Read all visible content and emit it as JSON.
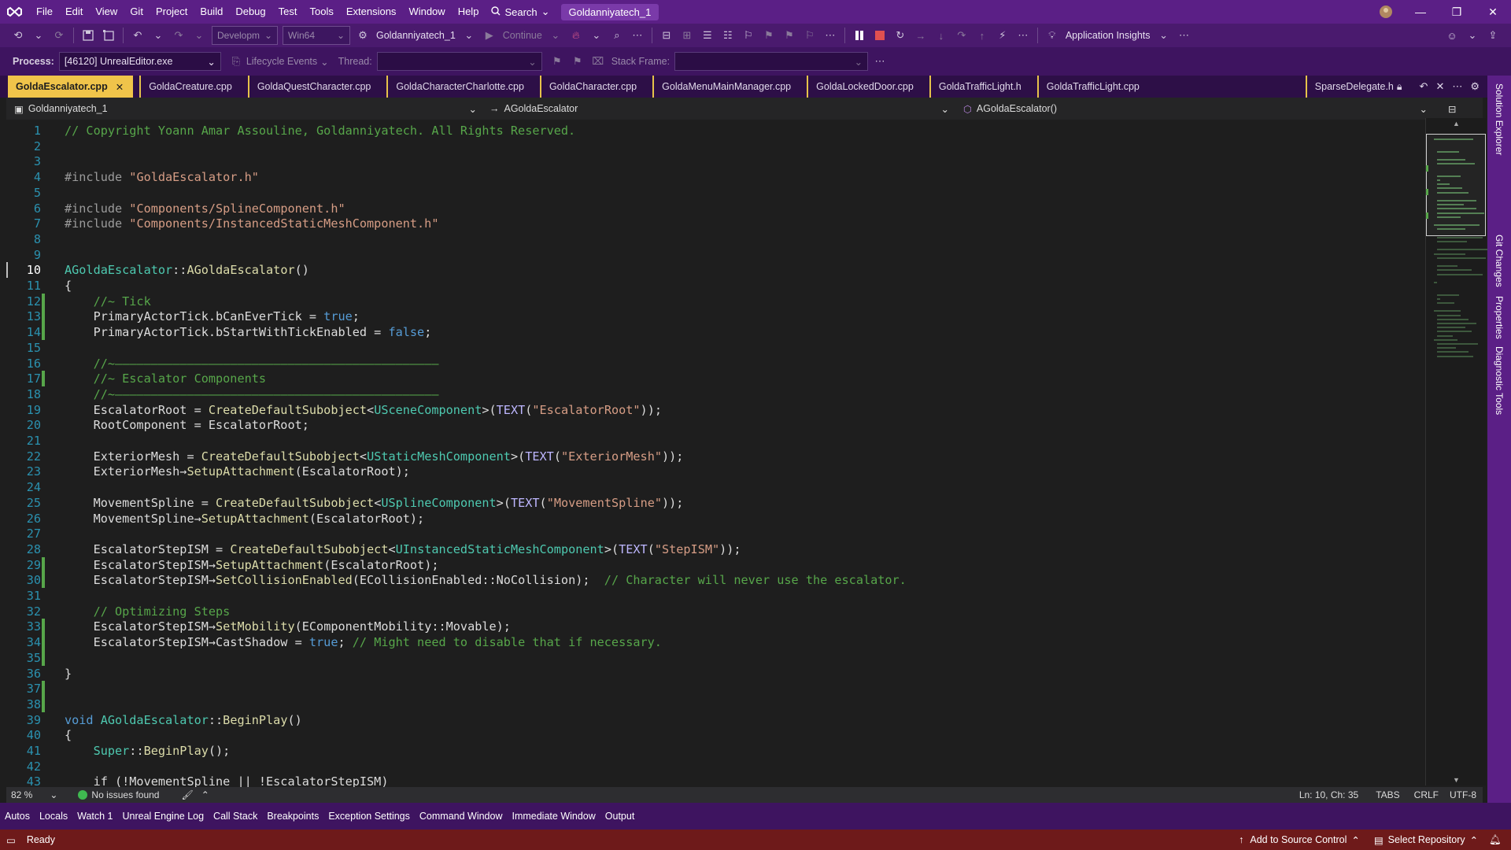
{
  "menubar": {
    "items": [
      "File",
      "Edit",
      "View",
      "Git",
      "Project",
      "Build",
      "Debug",
      "Test",
      "Tools",
      "Extensions",
      "Window",
      "Help"
    ],
    "search_label": "Search",
    "solution_name": "Goldanniyatech_1"
  },
  "toolbar": {
    "config": "Developm",
    "platform": "Win64",
    "startup_project": "Goldanniyatech_1",
    "continue_label": "Continue",
    "app_insights": "Application Insights"
  },
  "debugbar": {
    "process_label": "Process:",
    "process_value": "[46120] UnrealEditor.exe",
    "lifecycle_label": "Lifecycle Events",
    "thread_label": "Thread:",
    "stackframe_label": "Stack Frame:"
  },
  "tabs": {
    "items": [
      {
        "label": "GoldaEscalator.cpp",
        "active": true
      },
      {
        "label": "GoldaCreature.cpp"
      },
      {
        "label": "GoldaQuestCharacter.cpp"
      },
      {
        "label": "GoldaCharacterCharlotte.cpp"
      },
      {
        "label": "GoldaCharacter.cpp"
      },
      {
        "label": "GoldaMenuMainManager.cpp"
      },
      {
        "label": "GoldaLockedDoor.cpp"
      },
      {
        "label": "GoldaTrafficLight.h"
      },
      {
        "label": "GoldaTrafficLight.cpp"
      }
    ],
    "pinned": "SparseDelegate.h"
  },
  "navbar": {
    "project": "Goldanniyatech_1",
    "scope": "AGoldaEscalator",
    "member": "AGoldaEscalator()"
  },
  "rail": [
    "Solution Explorer",
    "Git Changes",
    "Properties",
    "Diagnostic Tools"
  ],
  "code": [
    {
      "n": "1",
      "parts": [
        [
          "cm",
          "// Copyright Yoann Amar Assouline, Goldanniyatech. All Rights Reserved."
        ]
      ]
    },
    {
      "n": "2",
      "parts": []
    },
    {
      "n": "3",
      "parts": []
    },
    {
      "n": "4",
      "parts": [
        [
          "pp",
          "#include "
        ],
        [
          "str",
          "\"GoldaEscalator.h\""
        ]
      ]
    },
    {
      "n": "5",
      "parts": []
    },
    {
      "n": "6",
      "parts": [
        [
          "pp",
          "#include "
        ],
        [
          "str",
          "\"Components/SplineComponent.h\""
        ]
      ]
    },
    {
      "n": "7",
      "parts": [
        [
          "pp",
          "#include "
        ],
        [
          "str",
          "\"Components/InstancedStaticMeshComponent.h\""
        ]
      ]
    },
    {
      "n": "8",
      "parts": []
    },
    {
      "n": "9",
      "parts": []
    },
    {
      "n": "10",
      "parts": [
        [
          "cls",
          "AGoldaEscalator"
        ],
        [
          "id",
          "::"
        ],
        [
          "fn",
          "AGoldaEscalator"
        ],
        [
          "id",
          "()"
        ]
      ]
    },
    {
      "n": "11",
      "parts": [
        [
          "id",
          "{"
        ]
      ]
    },
    {
      "n": "12",
      "parts": [
        [
          "cm",
          "    //~ Tick"
        ]
      ]
    },
    {
      "n": "13",
      "parts": [
        [
          "id",
          "    PrimaryActorTick.bCanEverTick = "
        ],
        [
          "kw",
          "true"
        ],
        [
          "id",
          ";"
        ]
      ]
    },
    {
      "n": "14",
      "parts": [
        [
          "id",
          "    PrimaryActorTick.bStartWithTickEnabled = "
        ],
        [
          "kw",
          "false"
        ],
        [
          "id",
          ";"
        ]
      ]
    },
    {
      "n": "15",
      "parts": []
    },
    {
      "n": "16",
      "parts": [
        [
          "cm",
          "    //~—————————————————————————————————————————————"
        ]
      ]
    },
    {
      "n": "17",
      "parts": [
        [
          "cm",
          "    //~ Escalator Components"
        ]
      ]
    },
    {
      "n": "18",
      "parts": [
        [
          "cm",
          "    //~—————————————————————————————————————————————"
        ]
      ]
    },
    {
      "n": "19",
      "parts": [
        [
          "id",
          "    EscalatorRoot = "
        ],
        [
          "fn",
          "CreateDefaultSubobject"
        ],
        [
          "id",
          "<"
        ],
        [
          "cls",
          "USceneComponent"
        ],
        [
          "id",
          ">("
        ],
        [
          "mac",
          "TEXT"
        ],
        [
          "id",
          "("
        ],
        [
          "str",
          "\"EscalatorRoot\""
        ],
        [
          "id",
          "));"
        ]
      ]
    },
    {
      "n": "20",
      "parts": [
        [
          "id",
          "    RootComponent = EscalatorRoot;"
        ]
      ]
    },
    {
      "n": "21",
      "parts": []
    },
    {
      "n": "22",
      "parts": [
        [
          "id",
          "    ExteriorMesh = "
        ],
        [
          "fn",
          "CreateDefaultSubobject"
        ],
        [
          "id",
          "<"
        ],
        [
          "cls",
          "UStaticMeshComponent"
        ],
        [
          "id",
          ">("
        ],
        [
          "mac",
          "TEXT"
        ],
        [
          "id",
          "("
        ],
        [
          "str",
          "\"ExteriorMesh\""
        ],
        [
          "id",
          "));"
        ]
      ]
    },
    {
      "n": "23",
      "parts": [
        [
          "id",
          "    ExteriorMesh→"
        ],
        [
          "fn",
          "SetupAttachment"
        ],
        [
          "id",
          "(EscalatorRoot);"
        ]
      ]
    },
    {
      "n": "24",
      "parts": []
    },
    {
      "n": "25",
      "parts": [
        [
          "id",
          "    MovementSpline = "
        ],
        [
          "fn",
          "CreateDefaultSubobject"
        ],
        [
          "id",
          "<"
        ],
        [
          "cls",
          "USplineComponent"
        ],
        [
          "id",
          ">("
        ],
        [
          "mac",
          "TEXT"
        ],
        [
          "id",
          "("
        ],
        [
          "str",
          "\"MovementSpline\""
        ],
        [
          "id",
          "));"
        ]
      ]
    },
    {
      "n": "26",
      "parts": [
        [
          "id",
          "    MovementSpline→"
        ],
        [
          "fn",
          "SetupAttachment"
        ],
        [
          "id",
          "(EscalatorRoot);"
        ]
      ]
    },
    {
      "n": "27",
      "parts": []
    },
    {
      "n": "28",
      "parts": [
        [
          "id",
          "    EscalatorStepISM = "
        ],
        [
          "fn",
          "CreateDefaultSubobject"
        ],
        [
          "id",
          "<"
        ],
        [
          "cls",
          "UInstancedStaticMeshComponent"
        ],
        [
          "id",
          ">("
        ],
        [
          "mac",
          "TEXT"
        ],
        [
          "id",
          "("
        ],
        [
          "str",
          "\"StepISM\""
        ],
        [
          "id",
          "));"
        ]
      ]
    },
    {
      "n": "29",
      "parts": [
        [
          "id",
          "    EscalatorStepISM→"
        ],
        [
          "fn",
          "SetupAttachment"
        ],
        [
          "id",
          "(EscalatorRoot);"
        ]
      ]
    },
    {
      "n": "30",
      "parts": [
        [
          "id",
          "    EscalatorStepISM→"
        ],
        [
          "fn",
          "SetCollisionEnabled"
        ],
        [
          "id",
          "(ECollisionEnabled::NoCollision);  "
        ],
        [
          "cm",
          "// Character will never use the escalator."
        ]
      ]
    },
    {
      "n": "31",
      "parts": []
    },
    {
      "n": "32",
      "parts": [
        [
          "cm",
          "    // Optimizing Steps"
        ]
      ]
    },
    {
      "n": "33",
      "parts": [
        [
          "id",
          "    EscalatorStepISM→"
        ],
        [
          "fn",
          "SetMobility"
        ],
        [
          "id",
          "(EComponentMobility::Movable);"
        ]
      ]
    },
    {
      "n": "34",
      "parts": [
        [
          "id",
          "    EscalatorStepISM→CastShadow = "
        ],
        [
          "kw",
          "true"
        ],
        [
          "id",
          "; "
        ],
        [
          "cm",
          "// Might need to disable that if necessary."
        ]
      ]
    },
    {
      "n": "35",
      "parts": []
    },
    {
      "n": "36",
      "parts": [
        [
          "id",
          "}"
        ]
      ]
    },
    {
      "n": "37",
      "parts": []
    },
    {
      "n": "38",
      "parts": []
    },
    {
      "n": "39",
      "parts": [
        [
          "kw",
          "void "
        ],
        [
          "cls",
          "AGoldaEscalator"
        ],
        [
          "id",
          "::"
        ],
        [
          "fn",
          "BeginPlay"
        ],
        [
          "id",
          "()"
        ]
      ]
    },
    {
      "n": "40",
      "parts": [
        [
          "id",
          "{"
        ]
      ]
    },
    {
      "n": "41",
      "parts": [
        [
          "id",
          "    "
        ],
        [
          "cls",
          "Super"
        ],
        [
          "id",
          "::"
        ],
        [
          "fn",
          "BeginPlay"
        ],
        [
          "id",
          "();"
        ]
      ]
    },
    {
      "n": "42",
      "parts": []
    },
    {
      "n": "43",
      "parts": [
        [
          "id",
          "    if (!MovementSpline || !EscalatorStepISM)"
        ]
      ]
    }
  ],
  "edstatus": {
    "zoom": "82 %",
    "issues": "No issues found",
    "position": "Ln: 10, Ch: 35",
    "indent": "TABS",
    "eol": "CRLF",
    "encoding": "UTF-8"
  },
  "tooltabs": [
    "Autos",
    "Locals",
    "Watch 1",
    "Unreal Engine Log",
    "Call Stack",
    "Breakpoints",
    "Exception Settings",
    "Command Window",
    "Immediate Window",
    "Output"
  ],
  "statusbar": {
    "ready": "Ready",
    "source_control": "Add to Source Control",
    "repository": "Select Repository"
  },
  "colors": {
    "menubar": "#5b1f86",
    "active_tab": "#f0c44a",
    "statusbar": "#6e1a1a",
    "comment": "#57a64a",
    "string": "#d69d85",
    "keyword": "#569cd6",
    "type": "#4ec9b0",
    "function": "#dcdcaa"
  }
}
